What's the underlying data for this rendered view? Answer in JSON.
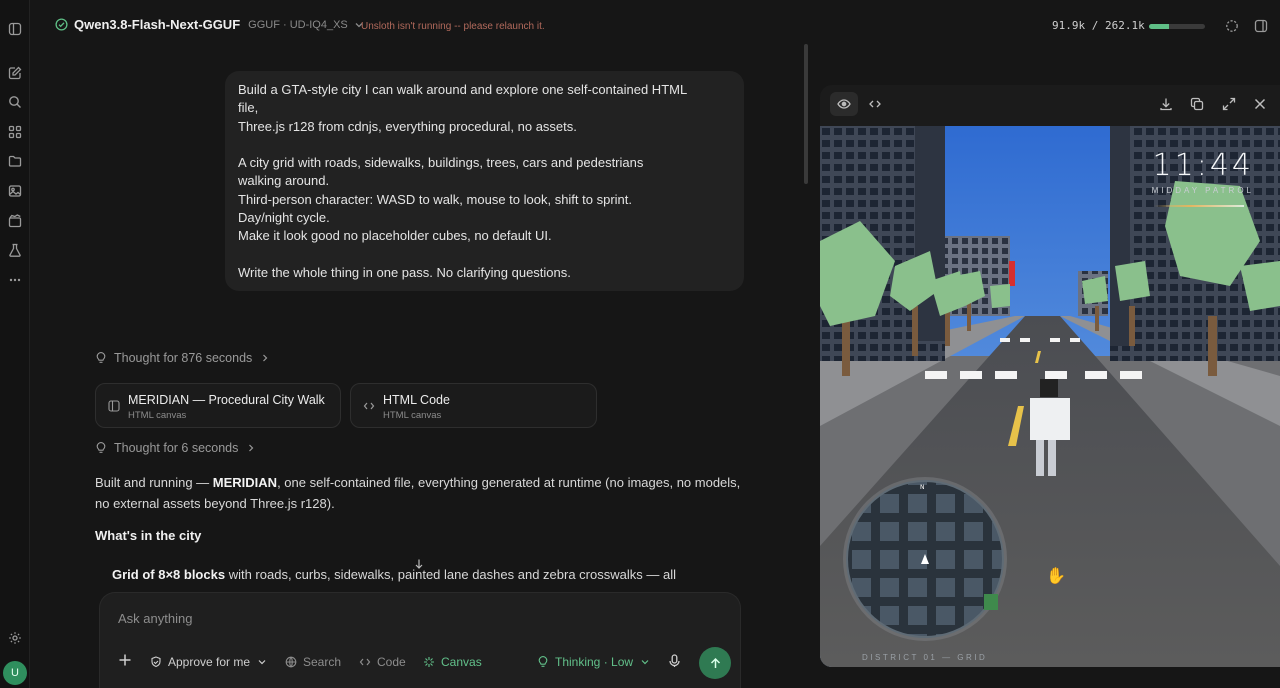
{
  "topbar": {
    "model_name": "Qwen3.8-Flash-Next-GGUF",
    "model_format": "GGUF · UD-IQ4_XS",
    "warning": "Unsloth isn't running -- please relaunch it.",
    "context_usage": "91.9k / 262.1k",
    "context_fraction": 0.35
  },
  "user_message": {
    "lines": [
      "Build a GTA-style city I can walk around and explore one self-contained HTML",
      "file,",
      "Three.js r128 from cdnjs, everything procedural, no assets.",
      "",
      "A city grid with roads, sidewalks, buildings, trees, cars and pedestrians",
      "walking around.",
      "Third-person character: WASD to walk, mouse to look, shift to sprint.",
      "Day/night cycle.",
      "Make it look good no placeholder cubes, no default UI.",
      "",
      "Write the whole thing in one pass. No clarifying questions."
    ]
  },
  "assistant": {
    "thought_1": "Thought for 876 seconds",
    "thought_2": "Thought for 6 seconds",
    "artifacts": [
      {
        "title": "MERIDIAN — Procedural City Walk",
        "subtitle": "HTML canvas"
      },
      {
        "title": "HTML Code",
        "subtitle": "HTML canvas"
      }
    ],
    "para_prefix": "Built and running — ",
    "para_bold": "MERIDIAN",
    "para_rest": ", one self-contained file, everything generated at runtime (no images, no models, no external assets beyond Three.js r128).",
    "heading": "What's in the city",
    "bullet_bold": "Grid of 8×8 blocks",
    "bullet_rest": " with roads, curbs, sidewalks, painted lane dashes and zebra crosswalks — all"
  },
  "composer": {
    "placeholder": "Ask anything",
    "approve": "Approve for me",
    "search": "Search",
    "code": "Code",
    "canvas": "Canvas",
    "thinking": "Thinking · Low"
  },
  "preview": {
    "hud_time": "11:44",
    "hud_subtitle": "MIDDAY PATROL",
    "hud_district": "DISTRICT 01 — GRID",
    "minimap_north": "N"
  },
  "user_avatar": "U",
  "colors": {
    "accent": "#2f7a52",
    "accent_text": "#62c08a",
    "warning": "#b26a5c",
    "background": "#161616"
  }
}
